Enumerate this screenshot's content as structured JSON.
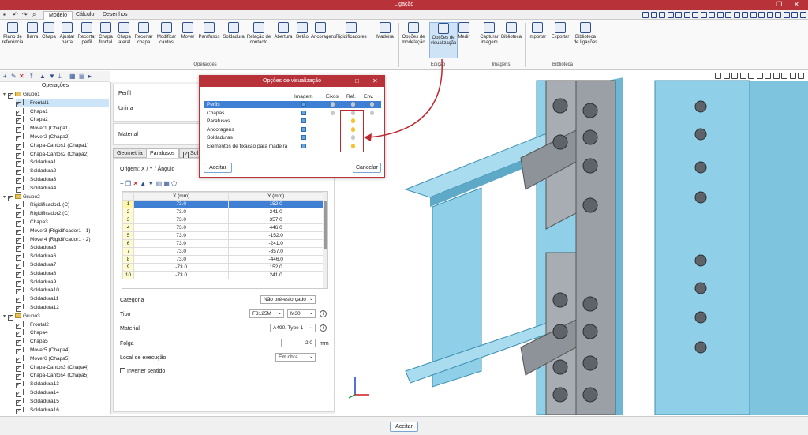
{
  "window": {
    "title": "Ligação"
  },
  "tabs": [
    "Modelo",
    "Cálculo",
    "Desenhos"
  ],
  "ribbon": {
    "groups": {
      "operacoes": "Operações",
      "edicao": "Edição",
      "imagens": "Imagens",
      "biblioteca": "Biblioteca"
    },
    "buttons": [
      [
        "Plano de",
        "referência"
      ],
      [
        "Barra",
        ""
      ],
      [
        "Chapa",
        ""
      ],
      [
        "Ajustar",
        "barra"
      ],
      [
        "Recortar",
        "perfil"
      ],
      [
        "Chapa",
        "frontal"
      ],
      [
        "Chapa",
        "lateral"
      ],
      [
        "Recortar",
        "chapa"
      ],
      [
        "Modificar",
        "cantos"
      ],
      [
        "Mover",
        ""
      ],
      [
        "Parafusos",
        ""
      ],
      [
        "Soldadura",
        ""
      ],
      [
        "Relação de",
        "contacto"
      ],
      [
        "Abertura",
        ""
      ],
      [
        "Betão",
        ""
      ],
      [
        "Ancoragens",
        ""
      ],
      [
        "Rigidificadores",
        ""
      ],
      [
        "Madeira",
        ""
      ],
      [
        "Opções de",
        "modelação"
      ],
      [
        "Opções de",
        "visualização"
      ],
      [
        "Medir",
        ""
      ],
      [
        "Capturar",
        "imagem"
      ],
      [
        "Biblioteca",
        ""
      ],
      [
        "Importar",
        ""
      ],
      [
        "Exportar",
        ""
      ],
      [
        "Biblioteca",
        "de ligações"
      ]
    ]
  },
  "left_panel": {
    "title": "Operações",
    "tree": [
      {
        "t": "Grupo1",
        "lvl": 0,
        "type": "group"
      },
      {
        "t": "Frontal1",
        "lvl": 1,
        "sel": true
      },
      {
        "t": "Chapa1",
        "lvl": 1
      },
      {
        "t": "Chapa2",
        "lvl": 1
      },
      {
        "t": "Mover1 (Chapa1)",
        "lvl": 1
      },
      {
        "t": "Mover2 (Chapa2)",
        "lvl": 1
      },
      {
        "t": "Chapa-Cantos1 (Chapa1)",
        "lvl": 1
      },
      {
        "t": "Chapa-Cantos2 (Chapa2)",
        "lvl": 1
      },
      {
        "t": "Soldadura1",
        "lvl": 1
      },
      {
        "t": "Soldadura2",
        "lvl": 1
      },
      {
        "t": "Soldadura3",
        "lvl": 1
      },
      {
        "t": "Soldadura4",
        "lvl": 1
      },
      {
        "t": "Grupo2",
        "lvl": 0,
        "type": "group"
      },
      {
        "t": "Rigidificador1 (C)",
        "lvl": 1
      },
      {
        "t": "Rigidificador2 (C)",
        "lvl": 1
      },
      {
        "t": "Chapa3",
        "lvl": 1
      },
      {
        "t": "Mover3 (Rigidificador1 - 1)",
        "lvl": 1
      },
      {
        "t": "Mover4 (Rigidificador1 - 2)",
        "lvl": 1
      },
      {
        "t": "Soldadura5",
        "lvl": 1
      },
      {
        "t": "Soldadura6",
        "lvl": 1
      },
      {
        "t": "Soldadura7",
        "lvl": 1
      },
      {
        "t": "Soldadura8",
        "lvl": 1
      },
      {
        "t": "Soldadura9",
        "lvl": 1
      },
      {
        "t": "Soldadura10",
        "lvl": 1
      },
      {
        "t": "Soldadura11",
        "lvl": 1
      },
      {
        "t": "Soldadura12",
        "lvl": 1
      },
      {
        "t": "Grupo3",
        "lvl": 0,
        "type": "group"
      },
      {
        "t": "Frontal2",
        "lvl": 1
      },
      {
        "t": "Chapa4",
        "lvl": 1
      },
      {
        "t": "Chapa5",
        "lvl": 1
      },
      {
        "t": "Mover5 (Chapa4)",
        "lvl": 1
      },
      {
        "t": "Mover6 (Chapa5)",
        "lvl": 1
      },
      {
        "t": "Chapa-Cantos3 (Chapa4)",
        "lvl": 1
      },
      {
        "t": "Chapa-Cantos4 (Chapa5)",
        "lvl": 1
      },
      {
        "t": "Soldadura13",
        "lvl": 1
      },
      {
        "t": "Soldadura14",
        "lvl": 1
      },
      {
        "t": "Soldadura15",
        "lvl": 1
      },
      {
        "t": "Soldadura16",
        "lvl": 1
      }
    ]
  },
  "props": {
    "perfil": "Perfil",
    "unir_a": "Unir a",
    "material": "Material",
    "tabs": [
      "Geometria",
      "Parafusos",
      "Sol"
    ],
    "origin": "Origem: X / Y / Ângulo",
    "columns": [
      "X (mm)",
      "Y (mm)"
    ],
    "rows": [
      [
        "1",
        "73.0",
        "152.0"
      ],
      [
        "2",
        "73.0",
        "241.0"
      ],
      [
        "3",
        "73.0",
        "357.0"
      ],
      [
        "4",
        "73.0",
        "446.0"
      ],
      [
        "5",
        "73.0",
        "-152.0"
      ],
      [
        "6",
        "73.0",
        "-241.0"
      ],
      [
        "7",
        "73.0",
        "-357.0"
      ],
      [
        "8",
        "73.0",
        "-446.0"
      ],
      [
        "9",
        "-73.0",
        "152.0"
      ],
      [
        "10",
        "-73.0",
        "241.0"
      ]
    ],
    "categoria_label": "Categoria",
    "categoria_val": "Não pré-esforçado",
    "tipo_label": "Tipo",
    "tipo_val1": "F3125M",
    "tipo_val2": "M30",
    "material_label": "Material",
    "material_val": "A490, Type 1",
    "folga_label": "Folga",
    "folga_val": "2.0",
    "folga_unit": "mm",
    "local_label": "Local de execução",
    "local_val": "Em obra",
    "inverter": "Inverter sentido"
  },
  "dialog": {
    "title": "Opções de visualização",
    "columns": [
      "Imagem",
      "Eixos",
      "Ref.",
      "Env."
    ],
    "rows": [
      "Perfis",
      "Chapas",
      "Parafusos",
      "Ancoragens",
      "Soldaduras",
      "Elementos de fixação para madeira"
    ],
    "accept": "Aceitar",
    "cancel": "Cancelar"
  },
  "bottom": {
    "accept": "Aceitar"
  },
  "colors": {
    "accent": "#b8323a",
    "selection": "#3f7fd4",
    "steel": "#8fd0e8"
  }
}
